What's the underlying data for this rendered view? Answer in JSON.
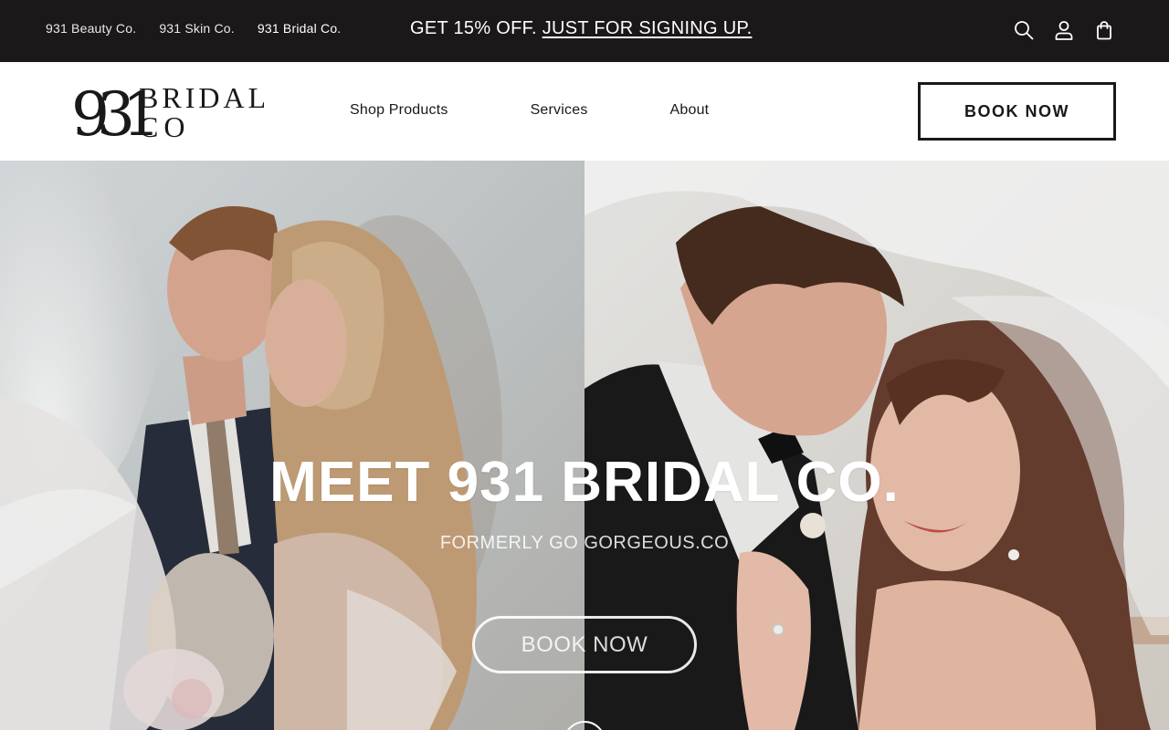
{
  "announcement": {
    "brand_links": [
      {
        "label": "931 Beauty Co."
      },
      {
        "label": "931 Skin Co."
      },
      {
        "label": "931 Bridal Co."
      }
    ],
    "promo_text": "GET 15% OFF.",
    "promo_link": "JUST FOR SIGNING UP.",
    "icons": [
      "search-icon",
      "account-icon",
      "cart-icon"
    ]
  },
  "header": {
    "logo": {
      "mark": "931",
      "line1": "BRIDAL",
      "line2": "CO"
    },
    "nav": [
      {
        "label": "Shop Products"
      },
      {
        "label": "Services"
      },
      {
        "label": "About"
      }
    ],
    "cta_label": "BOOK NOW"
  },
  "hero": {
    "title": "MEET 931 BRIDAL CO.",
    "subtitle": "FORMERLY GO GORGEOUS.CO",
    "cta_label": "BOOK NOW"
  },
  "colors": {
    "bar_background": "#1b1819",
    "text_dark": "#1b1819",
    "white": "#ffffff"
  }
}
